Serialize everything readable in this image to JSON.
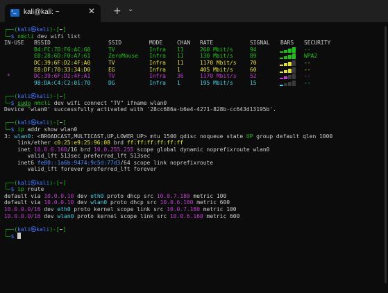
{
  "tabbar": {
    "tab_title": "kali@kali: ~",
    "close_glyph": "✕",
    "new_tab_glyph": "+",
    "dropdown_glyph": "⌄"
  },
  "prompt": {
    "user": "kali",
    "at": "㉿",
    "host": "kali",
    "dir": "~",
    "corner_top": "┌──(",
    "corner_close": ")-[",
    "dir_close": "]",
    "corner_bottom": "└─",
    "symbol": "$"
  },
  "commands": {
    "wifi_list": {
      "cmd": "nmcli",
      "args": " dev wifi list"
    },
    "wifi_connect": {
      "sudo": "sudo",
      "cmd": "nmcli",
      "args": " dev wifi connect \"TV\" ifname wlan0"
    },
    "ip_addr": {
      "cmd": "ip",
      "args": " addr show wlan0"
    },
    "ip_route": {
      "cmd": "ip",
      "args": " route"
    }
  },
  "wifi_table": {
    "headers": [
      "IN-USE",
      "BSSID",
      "SSID",
      "MODE",
      "CHAN",
      "RATE",
      "SIGNAL",
      "BARS",
      "SECURITY"
    ],
    "rows": [
      {
        "in_use": "",
        "bssid": "B4:FC:7D:F6:AC:68",
        "ssid": "TV",
        "mode": "Infra",
        "chan": "11",
        "rate": "260 Mbit/s",
        "signal": "94",
        "security": "--",
        "color": "#16c60c",
        "bars": 4
      },
      {
        "in_use": "",
        "bssid": "E8:28:6D:F0:A7:61",
        "ssid": "ZeroMouse",
        "mode": "Infra",
        "chan": "11",
        "rate": "130 Mbit/s",
        "signal": "89",
        "security": "WPA2",
        "color": "#16c60c",
        "bars": 4
      },
      {
        "in_use": "",
        "bssid": "DC:39:6F:D2:4F:A0",
        "ssid": "TV",
        "mode": "Infra",
        "chan": "11",
        "rate": "1170 Mbit/s",
        "signal": "70",
        "security": "--",
        "color": "#e5e510",
        "bars": 3
      },
      {
        "in_use": "",
        "bssid": "E8:DF:70:33:34:D0",
        "ssid": "EG",
        "mode": "Infra",
        "chan": "1",
        "rate": "405 Mbit/s",
        "signal": "60",
        "security": "--",
        "color": "#e5e510",
        "bars": 3
      },
      {
        "in_use": "*",
        "bssid": "DC:39:6F:D2:4F:A1",
        "ssid": "TV",
        "mode": "Infra",
        "chan": "36",
        "rate": "1170 Mbit/s",
        "signal": "52",
        "security": "--",
        "color": "#c23bd3",
        "bars": 2
      },
      {
        "in_use": "",
        "bssid": "98:DA:C4:C2:01:70",
        "ssid": "DG",
        "mode": "Infra",
        "chan": "1",
        "rate": "195 Mbit/s",
        "signal": "15",
        "security": "--",
        "color": "#3ad3e5",
        "bars": 1
      }
    ]
  },
  "connect_result": {
    "text_before": "Device 'wlan0' successfully activated with '",
    "uuid": "28cc686a-b6e4-4271-828b-cc643d13195b",
    "text_after": "'."
  },
  "ip_addr_output": {
    "l1_index": "3: ",
    "l1_iface": "wlan0",
    "l1_flags": ": <BROADCAST,MULTICAST,UP,LOWER_UP> mtu 1500 qdisc noqueue state ",
    "l1_state": "UP",
    "l1_rest": " group default qlen 1000",
    "l2_pre": "    link/ether ",
    "l2_mac": "c0:25:e9:25:96:08",
    "l2_mid": " brd ",
    "l2_brd": "ff:ff:ff:ff:ff:ff",
    "l3_pre": "    inet ",
    "l3_ip": "10.0.6.160",
    "l3_mid": "/16 brd ",
    "l3_brd": "10.0.255.255",
    "l3_rest": " scope global dynamic noprefixroute wlan0",
    "l4": "       valid_lft 513sec preferred_lft 513sec",
    "l5_pre": "    inet6 ",
    "l5_ip": "fe80::1a6b:9474:9c5d:77d3",
    "l5_rest": "/64 scope link noprefixroute",
    "l6": "       valid_lft forever preferred_lft forever"
  },
  "ip_route_output": [
    {
      "a": "default via ",
      "ip1": "10.0.0.10",
      "b": " dev ",
      "dev": "eth0",
      "c": " proto dhcp src ",
      "ip2": "10.0.7.180",
      "d": " metric 100"
    },
    {
      "a": "default via ",
      "ip1": "10.0.0.10",
      "b": " dev ",
      "dev": "wlan0",
      "c": " proto dhcp src ",
      "ip2": "10.0.6.160",
      "d": " metric 600"
    },
    {
      "a": "",
      "ip1": "10.0.0.0/16",
      "b": " dev ",
      "dev": "eth0",
      "c": " proto kernel scope link src ",
      "ip2": "10.0.7.180",
      "d": " metric 100"
    },
    {
      "a": "",
      "ip1": "10.0.0.0/16",
      "b": " dev ",
      "dev": "wlan0",
      "c": " proto kernel scope link src ",
      "ip2": "10.0.6.160",
      "d": " metric 600"
    }
  ],
  "colors": {
    "background": "#0c0c0c",
    "tabbar": "#202020",
    "prompt_green": "#16c60c",
    "prompt_blue": "#3b78ff",
    "ip_magenta": "#c23bd3",
    "mac_yellow": "#e5e510",
    "ipv6_cyan": "#3ad3e5"
  }
}
